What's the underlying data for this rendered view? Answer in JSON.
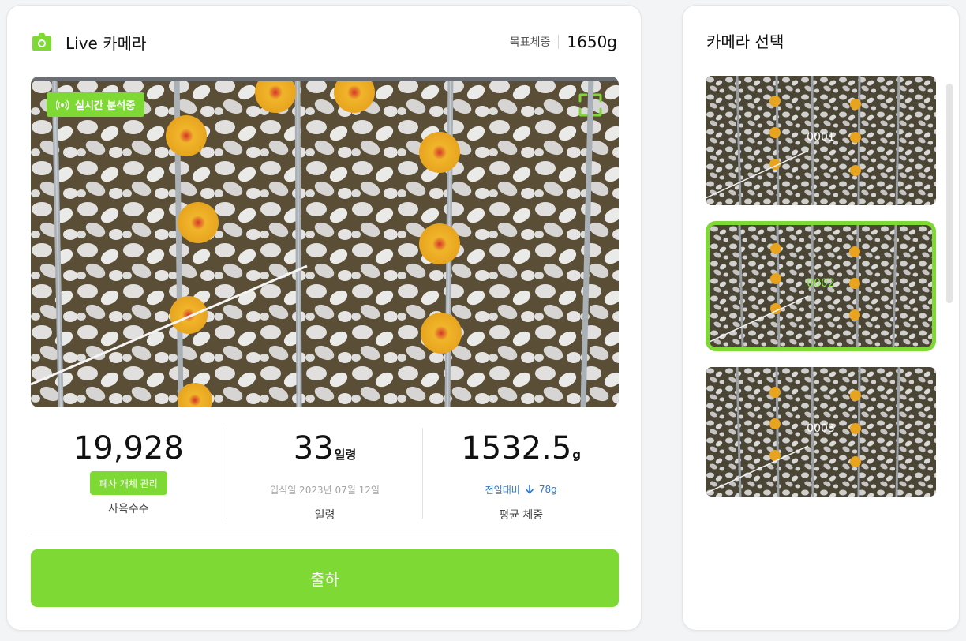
{
  "header": {
    "title": "Live 카메라",
    "target_weight_label": "목표체중",
    "target_weight_value": "1650g"
  },
  "live": {
    "badge": "실시간 분석중"
  },
  "stats": [
    {
      "value": "19,928",
      "unit": "",
      "action": "폐사 개체 관리",
      "label": "사육수수"
    },
    {
      "value": "33",
      "unit": "일령",
      "sub": "입식일 2023년 07월 12일",
      "label": "일령"
    },
    {
      "value": "1532.5",
      "unit": "g",
      "delta_prefix": "전일대비",
      "delta_value": "78g",
      "label": "평균 체중"
    }
  ],
  "ship_button": "출하",
  "side": {
    "title": "카메라 선택",
    "cameras": [
      {
        "id": "0001",
        "selected": false
      },
      {
        "id": "0002",
        "selected": true
      },
      {
        "id": "0003",
        "selected": false
      }
    ]
  },
  "colors": {
    "accent": "#7ed934",
    "delta": "#2f7bd6",
    "floor": "#5a4e36",
    "feeder": "#e8a41f"
  }
}
